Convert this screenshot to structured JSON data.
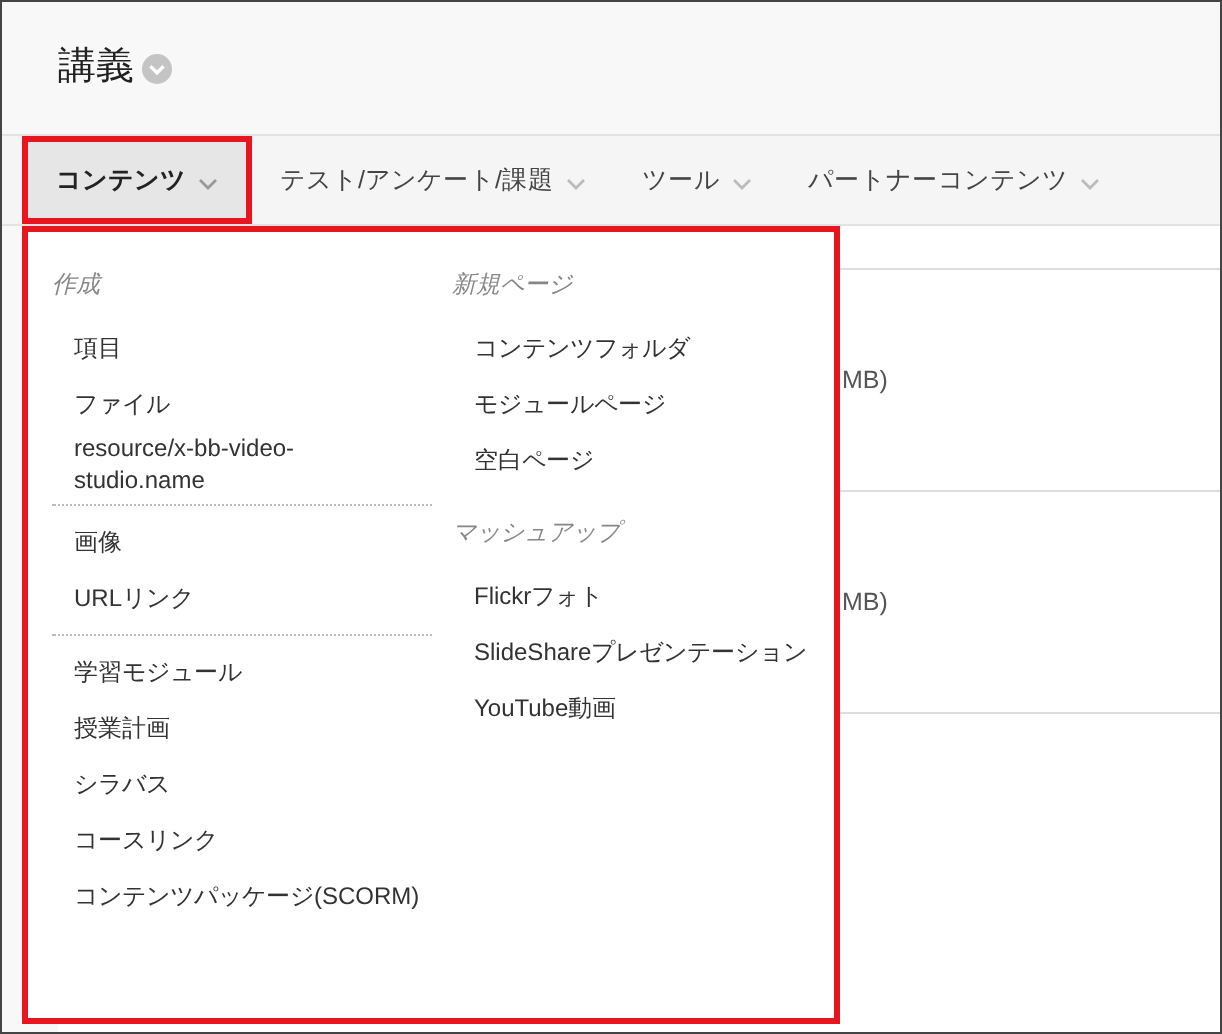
{
  "header": {
    "title": "講義"
  },
  "tabs": [
    {
      "label": "コンテンツ",
      "selected": true
    },
    {
      "label": "テスト/アンケート/課題",
      "selected": false
    },
    {
      "label": "ツール",
      "selected": false
    },
    {
      "label": "パートナーコンテンツ",
      "selected": false
    }
  ],
  "menu": {
    "columns": [
      {
        "sections": [
          {
            "heading": "作成",
            "items": [
              "項目",
              "ファイル",
              "resource/x-bb-video-studio.name"
            ]
          },
          {
            "items": [
              "画像",
              "URLリンク"
            ]
          },
          {
            "items": [
              "学習モジュール",
              "授業計画",
              "シラバス",
              "コースリンク",
              "コンテンツパッケージ(SCORM)"
            ]
          }
        ]
      },
      {
        "sections": [
          {
            "heading": "新規ページ",
            "items": [
              "コンテンツフォルダ",
              "モジュールページ",
              "空白ページ"
            ]
          },
          {
            "heading": "マッシュアップ",
            "items": [
              "Flickrフォト",
              "SlideShareプレゼンテーション",
              "YouTube動画"
            ]
          }
        ]
      }
    ]
  },
  "content_rows": [
    {
      "text": "MB)"
    },
    {
      "text": "MB)"
    }
  ]
}
